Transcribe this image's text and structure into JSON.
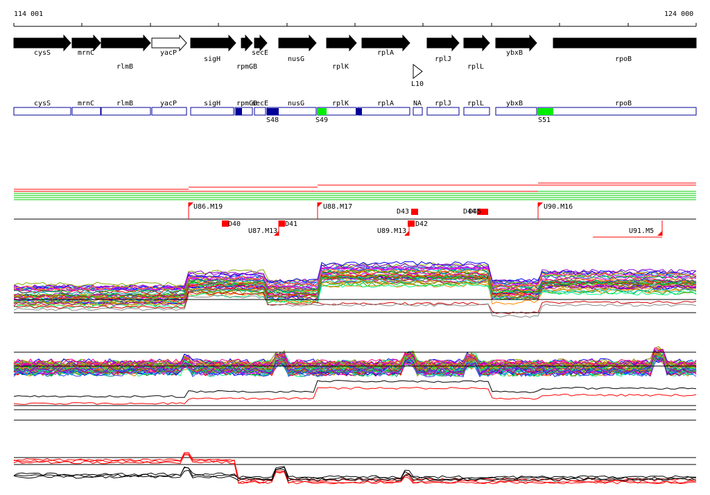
{
  "scale": {
    "start": "114 001",
    "end": "124 000"
  },
  "genes": [
    {
      "name": "cysS",
      "strand": "+",
      "filled": true
    },
    {
      "name": "mrnC",
      "strand": "+",
      "filled": true
    },
    {
      "name": "rlmB",
      "strand": "+",
      "filled": true
    },
    {
      "name": "yacP",
      "strand": "+",
      "filled": false
    },
    {
      "name": "sigH",
      "strand": "+",
      "filled": true
    },
    {
      "name": "rpmGB",
      "strand": "+",
      "filled": true
    },
    {
      "name": "secE",
      "strand": "+",
      "filled": true
    },
    {
      "name": "nusG",
      "strand": "+",
      "filled": true
    },
    {
      "name": "rplK",
      "strand": "+",
      "filled": true
    },
    {
      "name": "rplA",
      "strand": "+",
      "filled": true
    },
    {
      "name": "L10",
      "strand": "+",
      "filled": false
    },
    {
      "name": "rplJ",
      "strand": "+",
      "filled": true
    },
    {
      "name": "rplL",
      "strand": "+",
      "filled": true
    },
    {
      "name": "ybxB",
      "strand": "+",
      "filled": true
    },
    {
      "name": "rpoB",
      "strand": "none",
      "filled": true
    }
  ],
  "segments": [
    {
      "name": "cysS"
    },
    {
      "name": "mrnC"
    },
    {
      "name": "rlmB"
    },
    {
      "name": "yacP"
    },
    {
      "name": "sigH"
    },
    {
      "name": "rpmGB"
    },
    {
      "name": "secE"
    },
    {
      "name": "nusG"
    },
    {
      "name": "rplK"
    },
    {
      "name": "rplA"
    },
    {
      "name": "NA"
    },
    {
      "name": "rplJ"
    },
    {
      "name": "rplL"
    },
    {
      "name": "ybxB"
    },
    {
      "name": "rpoB"
    }
  ],
  "sites": [
    {
      "label": "S48",
      "color": "#000099"
    },
    {
      "label": "S49",
      "color": "#00ee00"
    },
    {
      "label": "S51",
      "color": "#00ee00"
    }
  ],
  "upshifts": [
    {
      "label": "U86.M19"
    },
    {
      "label": "U88.M17"
    },
    {
      "label": "U90.M16"
    }
  ],
  "downshifts": [
    {
      "label": "U87.M13"
    },
    {
      "label": "U89.M13"
    },
    {
      "label": "U91.M5"
    }
  ],
  "dels": [
    {
      "label": "D40"
    },
    {
      "label": "D41"
    },
    {
      "label": "D42"
    },
    {
      "label": "D43"
    },
    {
      "label": "D44"
    },
    {
      "label": "D45"
    }
  ],
  "colors": {
    "gene_fill": "#000000",
    "segment_outline": "#000099",
    "marker_red": "#ff0000",
    "level_green": "#00cc00",
    "level_red": "#ff0000"
  }
}
